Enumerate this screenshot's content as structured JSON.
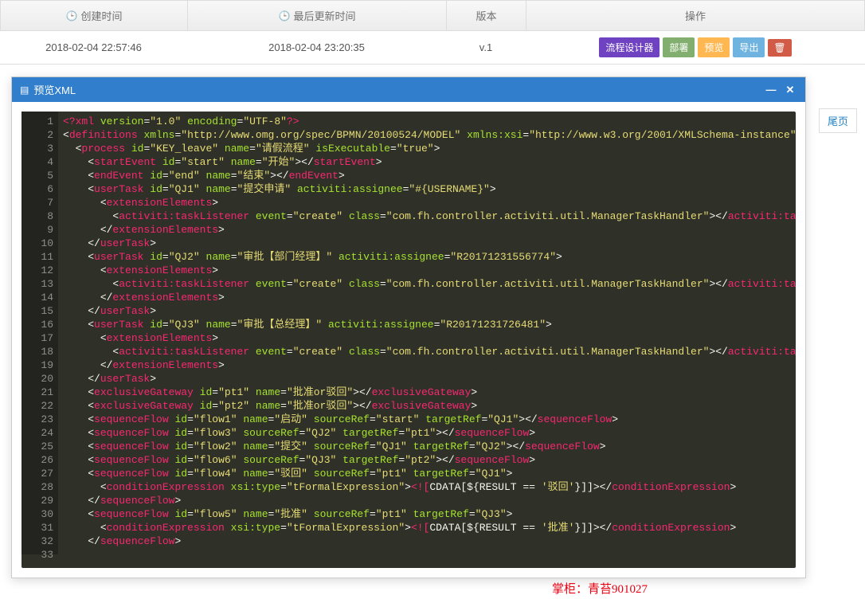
{
  "table": {
    "headers": {
      "created": "创建时间",
      "updated": "最后更新时间",
      "version": "版本",
      "actions": "操作"
    },
    "row": {
      "created": "2018-02-04 22:57:46",
      "updated": "2018-02-04 23:20:35",
      "version": "v.1"
    },
    "buttons": {
      "designer": "流程设计器",
      "deploy": "部署",
      "preview": "预览",
      "export": "导出"
    }
  },
  "pagination": {
    "last": "尾页"
  },
  "modal": {
    "title": "预览XML"
  },
  "watermark": "掌柜：青苔901027",
  "code": [
    [
      [
        "pi",
        "<?"
      ],
      [
        "tag",
        "xml"
      ],
      [
        "text",
        " "
      ],
      [
        "attr",
        "version"
      ],
      [
        "text",
        "="
      ],
      [
        "str",
        "\"1.0\""
      ],
      [
        "text",
        " "
      ],
      [
        "attr",
        "encoding"
      ],
      [
        "text",
        "="
      ],
      [
        "str",
        "\"UTF-8\""
      ],
      [
        "pi",
        "?>"
      ]
    ],
    [
      [
        "brkt",
        "<"
      ],
      [
        "tag",
        "definitions"
      ],
      [
        "text",
        " "
      ],
      [
        "attr",
        "xmlns"
      ],
      [
        "text",
        "="
      ],
      [
        "str",
        "\"http://www.omg.org/spec/BPMN/20100524/MODEL\""
      ],
      [
        "text",
        " "
      ],
      [
        "attr",
        "xmlns:xsi"
      ],
      [
        "text",
        "="
      ],
      [
        "str",
        "\"http://www.w3.org/2001/XMLSchema-instance\""
      ]
    ],
    [
      [
        "text",
        "  "
      ],
      [
        "brkt",
        "<"
      ],
      [
        "tag",
        "process"
      ],
      [
        "text",
        " "
      ],
      [
        "attr",
        "id"
      ],
      [
        "text",
        "="
      ],
      [
        "str",
        "\"KEY_leave\""
      ],
      [
        "text",
        " "
      ],
      [
        "attr",
        "name"
      ],
      [
        "text",
        "="
      ],
      [
        "str",
        "\"请假流程\""
      ],
      [
        "text",
        " "
      ],
      [
        "attr",
        "isExecutable"
      ],
      [
        "text",
        "="
      ],
      [
        "str",
        "\"true\""
      ],
      [
        "brkt",
        ">"
      ]
    ],
    [
      [
        "text",
        "    "
      ],
      [
        "brkt",
        "<"
      ],
      [
        "tag",
        "startEvent"
      ],
      [
        "text",
        " "
      ],
      [
        "attr",
        "id"
      ],
      [
        "text",
        "="
      ],
      [
        "str",
        "\"start\""
      ],
      [
        "text",
        " "
      ],
      [
        "attr",
        "name"
      ],
      [
        "text",
        "="
      ],
      [
        "str",
        "\"开始\""
      ],
      [
        "brkt",
        "></"
      ],
      [
        "tag",
        "startEvent"
      ],
      [
        "brkt",
        ">"
      ]
    ],
    [
      [
        "text",
        "    "
      ],
      [
        "brkt",
        "<"
      ],
      [
        "tag",
        "endEvent"
      ],
      [
        "text",
        " "
      ],
      [
        "attr",
        "id"
      ],
      [
        "text",
        "="
      ],
      [
        "str",
        "\"end\""
      ],
      [
        "text",
        " "
      ],
      [
        "attr",
        "name"
      ],
      [
        "text",
        "="
      ],
      [
        "str",
        "\"结束\""
      ],
      [
        "brkt",
        "></"
      ],
      [
        "tag",
        "endEvent"
      ],
      [
        "brkt",
        ">"
      ]
    ],
    [
      [
        "text",
        "    "
      ],
      [
        "brkt",
        "<"
      ],
      [
        "tag",
        "userTask"
      ],
      [
        "text",
        " "
      ],
      [
        "attr",
        "id"
      ],
      [
        "text",
        "="
      ],
      [
        "str",
        "\"QJ1\""
      ],
      [
        "text",
        " "
      ],
      [
        "attr",
        "name"
      ],
      [
        "text",
        "="
      ],
      [
        "str",
        "\"提交申请\""
      ],
      [
        "text",
        " "
      ],
      [
        "attr",
        "activiti:assignee"
      ],
      [
        "text",
        "="
      ],
      [
        "str",
        "\"#{USERNAME}\""
      ],
      [
        "brkt",
        ">"
      ]
    ],
    [
      [
        "text",
        "      "
      ],
      [
        "brkt",
        "<"
      ],
      [
        "tag",
        "extensionElements"
      ],
      [
        "brkt",
        ">"
      ]
    ],
    [
      [
        "text",
        "        "
      ],
      [
        "brkt",
        "<"
      ],
      [
        "tag",
        "activiti:taskListener"
      ],
      [
        "text",
        " "
      ],
      [
        "attr",
        "event"
      ],
      [
        "text",
        "="
      ],
      [
        "str",
        "\"create\""
      ],
      [
        "text",
        " "
      ],
      [
        "attr",
        "class"
      ],
      [
        "text",
        "="
      ],
      [
        "str",
        "\"com.fh.controller.activiti.util.ManagerTaskHandler\""
      ],
      [
        "brkt",
        "></"
      ],
      [
        "tag",
        "activiti:taskListener"
      ],
      [
        "brkt",
        ">"
      ]
    ],
    [
      [
        "text",
        "      "
      ],
      [
        "brkt",
        "</"
      ],
      [
        "tag",
        "extensionElements"
      ],
      [
        "brkt",
        ">"
      ]
    ],
    [
      [
        "text",
        "    "
      ],
      [
        "brkt",
        "</"
      ],
      [
        "tag",
        "userTask"
      ],
      [
        "brkt",
        ">"
      ]
    ],
    [
      [
        "text",
        "    "
      ],
      [
        "brkt",
        "<"
      ],
      [
        "tag",
        "userTask"
      ],
      [
        "text",
        " "
      ],
      [
        "attr",
        "id"
      ],
      [
        "text",
        "="
      ],
      [
        "str",
        "\"QJ2\""
      ],
      [
        "text",
        " "
      ],
      [
        "attr",
        "name"
      ],
      [
        "text",
        "="
      ],
      [
        "str",
        "\"审批【部门经理】\""
      ],
      [
        "text",
        " "
      ],
      [
        "attr",
        "activiti:assignee"
      ],
      [
        "text",
        "="
      ],
      [
        "str",
        "\"R20171231556774\""
      ],
      [
        "brkt",
        ">"
      ]
    ],
    [
      [
        "text",
        "      "
      ],
      [
        "brkt",
        "<"
      ],
      [
        "tag",
        "extensionElements"
      ],
      [
        "brkt",
        ">"
      ]
    ],
    [
      [
        "text",
        "        "
      ],
      [
        "brkt",
        "<"
      ],
      [
        "tag",
        "activiti:taskListener"
      ],
      [
        "text",
        " "
      ],
      [
        "attr",
        "event"
      ],
      [
        "text",
        "="
      ],
      [
        "str",
        "\"create\""
      ],
      [
        "text",
        " "
      ],
      [
        "attr",
        "class"
      ],
      [
        "text",
        "="
      ],
      [
        "str",
        "\"com.fh.controller.activiti.util.ManagerTaskHandler\""
      ],
      [
        "brkt",
        "></"
      ],
      [
        "tag",
        "activiti:taskListener"
      ],
      [
        "brkt",
        ">"
      ]
    ],
    [
      [
        "text",
        "      "
      ],
      [
        "brkt",
        "</"
      ],
      [
        "tag",
        "extensionElements"
      ],
      [
        "brkt",
        ">"
      ]
    ],
    [
      [
        "text",
        "    "
      ],
      [
        "brkt",
        "</"
      ],
      [
        "tag",
        "userTask"
      ],
      [
        "brkt",
        ">"
      ]
    ],
    [
      [
        "text",
        "    "
      ],
      [
        "brkt",
        "<"
      ],
      [
        "tag",
        "userTask"
      ],
      [
        "text",
        " "
      ],
      [
        "attr",
        "id"
      ],
      [
        "text",
        "="
      ],
      [
        "str",
        "\"QJ3\""
      ],
      [
        "text",
        " "
      ],
      [
        "attr",
        "name"
      ],
      [
        "text",
        "="
      ],
      [
        "str",
        "\"审批【总经理】\""
      ],
      [
        "text",
        " "
      ],
      [
        "attr",
        "activiti:assignee"
      ],
      [
        "text",
        "="
      ],
      [
        "str",
        "\"R20171231726481\""
      ],
      [
        "brkt",
        ">"
      ]
    ],
    [
      [
        "text",
        "      "
      ],
      [
        "brkt",
        "<"
      ],
      [
        "tag",
        "extensionElements"
      ],
      [
        "brkt",
        ">"
      ]
    ],
    [
      [
        "text",
        "        "
      ],
      [
        "brkt",
        "<"
      ],
      [
        "tag",
        "activiti:taskListener"
      ],
      [
        "text",
        " "
      ],
      [
        "attr",
        "event"
      ],
      [
        "text",
        "="
      ],
      [
        "str",
        "\"create\""
      ],
      [
        "text",
        " "
      ],
      [
        "attr",
        "class"
      ],
      [
        "text",
        "="
      ],
      [
        "str",
        "\"com.fh.controller.activiti.util.ManagerTaskHandler\""
      ],
      [
        "brkt",
        "></"
      ],
      [
        "tag",
        "activiti:taskListener"
      ],
      [
        "brkt",
        ">"
      ]
    ],
    [
      [
        "text",
        "      "
      ],
      [
        "brkt",
        "</"
      ],
      [
        "tag",
        "extensionElements"
      ],
      [
        "brkt",
        ">"
      ]
    ],
    [
      [
        "text",
        "    "
      ],
      [
        "brkt",
        "</"
      ],
      [
        "tag",
        "userTask"
      ],
      [
        "brkt",
        ">"
      ]
    ],
    [
      [
        "text",
        "    "
      ],
      [
        "brkt",
        "<"
      ],
      [
        "tag",
        "exclusiveGateway"
      ],
      [
        "text",
        " "
      ],
      [
        "attr",
        "id"
      ],
      [
        "text",
        "="
      ],
      [
        "str",
        "\"pt1\""
      ],
      [
        "text",
        " "
      ],
      [
        "attr",
        "name"
      ],
      [
        "text",
        "="
      ],
      [
        "str",
        "\"批准or驳回\""
      ],
      [
        "brkt",
        "></"
      ],
      [
        "tag",
        "exclusiveGateway"
      ],
      [
        "brkt",
        ">"
      ]
    ],
    [
      [
        "text",
        "    "
      ],
      [
        "brkt",
        "<"
      ],
      [
        "tag",
        "exclusiveGateway"
      ],
      [
        "text",
        " "
      ],
      [
        "attr",
        "id"
      ],
      [
        "text",
        "="
      ],
      [
        "str",
        "\"pt2\""
      ],
      [
        "text",
        " "
      ],
      [
        "attr",
        "name"
      ],
      [
        "text",
        "="
      ],
      [
        "str",
        "\"批准or驳回\""
      ],
      [
        "brkt",
        "></"
      ],
      [
        "tag",
        "exclusiveGateway"
      ],
      [
        "brkt",
        ">"
      ]
    ],
    [
      [
        "text",
        "    "
      ],
      [
        "brkt",
        "<"
      ],
      [
        "tag",
        "sequenceFlow"
      ],
      [
        "text",
        " "
      ],
      [
        "attr",
        "id"
      ],
      [
        "text",
        "="
      ],
      [
        "str",
        "\"flow1\""
      ],
      [
        "text",
        " "
      ],
      [
        "attr",
        "name"
      ],
      [
        "text",
        "="
      ],
      [
        "str",
        "\"启动\""
      ],
      [
        "text",
        " "
      ],
      [
        "attr",
        "sourceRef"
      ],
      [
        "text",
        "="
      ],
      [
        "str",
        "\"start\""
      ],
      [
        "text",
        " "
      ],
      [
        "attr",
        "targetRef"
      ],
      [
        "text",
        "="
      ],
      [
        "str",
        "\"QJ1\""
      ],
      [
        "brkt",
        "></"
      ],
      [
        "tag",
        "sequenceFlow"
      ],
      [
        "brkt",
        ">"
      ]
    ],
    [
      [
        "text",
        "    "
      ],
      [
        "brkt",
        "<"
      ],
      [
        "tag",
        "sequenceFlow"
      ],
      [
        "text",
        " "
      ],
      [
        "attr",
        "id"
      ],
      [
        "text",
        "="
      ],
      [
        "str",
        "\"flow3\""
      ],
      [
        "text",
        " "
      ],
      [
        "attr",
        "sourceRef"
      ],
      [
        "text",
        "="
      ],
      [
        "str",
        "\"QJ2\""
      ],
      [
        "text",
        " "
      ],
      [
        "attr",
        "targetRef"
      ],
      [
        "text",
        "="
      ],
      [
        "str",
        "\"pt1\""
      ],
      [
        "brkt",
        "></"
      ],
      [
        "tag",
        "sequenceFlow"
      ],
      [
        "brkt",
        ">"
      ]
    ],
    [
      [
        "text",
        "    "
      ],
      [
        "brkt",
        "<"
      ],
      [
        "tag",
        "sequenceFlow"
      ],
      [
        "text",
        " "
      ],
      [
        "attr",
        "id"
      ],
      [
        "text",
        "="
      ],
      [
        "str",
        "\"flow2\""
      ],
      [
        "text",
        " "
      ],
      [
        "attr",
        "name"
      ],
      [
        "text",
        "="
      ],
      [
        "str",
        "\"提交\""
      ],
      [
        "text",
        " "
      ],
      [
        "attr",
        "sourceRef"
      ],
      [
        "text",
        "="
      ],
      [
        "str",
        "\"QJ1\""
      ],
      [
        "text",
        " "
      ],
      [
        "attr",
        "targetRef"
      ],
      [
        "text",
        "="
      ],
      [
        "str",
        "\"QJ2\""
      ],
      [
        "brkt",
        "></"
      ],
      [
        "tag",
        "sequenceFlow"
      ],
      [
        "brkt",
        ">"
      ]
    ],
    [
      [
        "text",
        "    "
      ],
      [
        "brkt",
        "<"
      ],
      [
        "tag",
        "sequenceFlow"
      ],
      [
        "text",
        " "
      ],
      [
        "attr",
        "id"
      ],
      [
        "text",
        "="
      ],
      [
        "str",
        "\"flow6\""
      ],
      [
        "text",
        " "
      ],
      [
        "attr",
        "sourceRef"
      ],
      [
        "text",
        "="
      ],
      [
        "str",
        "\"QJ3\""
      ],
      [
        "text",
        " "
      ],
      [
        "attr",
        "targetRef"
      ],
      [
        "text",
        "="
      ],
      [
        "str",
        "\"pt2\""
      ],
      [
        "brkt",
        "></"
      ],
      [
        "tag",
        "sequenceFlow"
      ],
      [
        "brkt",
        ">"
      ]
    ],
    [
      [
        "text",
        "    "
      ],
      [
        "brkt",
        "<"
      ],
      [
        "tag",
        "sequenceFlow"
      ],
      [
        "text",
        " "
      ],
      [
        "attr",
        "id"
      ],
      [
        "text",
        "="
      ],
      [
        "str",
        "\"flow4\""
      ],
      [
        "text",
        " "
      ],
      [
        "attr",
        "name"
      ],
      [
        "text",
        "="
      ],
      [
        "str",
        "\"驳回\""
      ],
      [
        "text",
        " "
      ],
      [
        "attr",
        "sourceRef"
      ],
      [
        "text",
        "="
      ],
      [
        "str",
        "\"pt1\""
      ],
      [
        "text",
        " "
      ],
      [
        "attr",
        "targetRef"
      ],
      [
        "text",
        "="
      ],
      [
        "str",
        "\"QJ1\""
      ],
      [
        "brkt",
        ">"
      ]
    ],
    [
      [
        "text",
        "      "
      ],
      [
        "brkt",
        "<"
      ],
      [
        "tag",
        "conditionExpression"
      ],
      [
        "text",
        " "
      ],
      [
        "attr",
        "xsi:type"
      ],
      [
        "text",
        "="
      ],
      [
        "str",
        "\"tFormalExpression\""
      ],
      [
        "brkt",
        ">"
      ],
      [
        "pi",
        "<!["
      ],
      [
        "text",
        "CDATA[${RESULT == "
      ],
      [
        "str",
        "'驳回'"
      ],
      [
        "text",
        "}]]"
      ],
      [
        "brkt",
        "></"
      ],
      [
        "tag",
        "conditionExpression"
      ],
      [
        "brkt",
        ">"
      ]
    ],
    [
      [
        "text",
        "    "
      ],
      [
        "brkt",
        "</"
      ],
      [
        "tag",
        "sequenceFlow"
      ],
      [
        "brkt",
        ">"
      ]
    ],
    [
      [
        "text",
        "    "
      ],
      [
        "brkt",
        "<"
      ],
      [
        "tag",
        "sequenceFlow"
      ],
      [
        "text",
        " "
      ],
      [
        "attr",
        "id"
      ],
      [
        "text",
        "="
      ],
      [
        "str",
        "\"flow5\""
      ],
      [
        "text",
        " "
      ],
      [
        "attr",
        "name"
      ],
      [
        "text",
        "="
      ],
      [
        "str",
        "\"批准\""
      ],
      [
        "text",
        " "
      ],
      [
        "attr",
        "sourceRef"
      ],
      [
        "text",
        "="
      ],
      [
        "str",
        "\"pt1\""
      ],
      [
        "text",
        " "
      ],
      [
        "attr",
        "targetRef"
      ],
      [
        "text",
        "="
      ],
      [
        "str",
        "\"QJ3\""
      ],
      [
        "brkt",
        ">"
      ]
    ],
    [
      [
        "text",
        "      "
      ],
      [
        "brkt",
        "<"
      ],
      [
        "tag",
        "conditionExpression"
      ],
      [
        "text",
        " "
      ],
      [
        "attr",
        "xsi:type"
      ],
      [
        "text",
        "="
      ],
      [
        "str",
        "\"tFormalExpression\""
      ],
      [
        "brkt",
        ">"
      ],
      [
        "pi",
        "<!["
      ],
      [
        "text",
        "CDATA[${RESULT == "
      ],
      [
        "str",
        "'批准'"
      ],
      [
        "text",
        "}]]"
      ],
      [
        "brkt",
        "></"
      ],
      [
        "tag",
        "conditionExpression"
      ],
      [
        "brkt",
        ">"
      ]
    ],
    [
      [
        "text",
        "    "
      ],
      [
        "brkt",
        "</"
      ],
      [
        "tag",
        "sequenceFlow"
      ],
      [
        "brkt",
        ">"
      ]
    ],
    [
      [
        "text",
        "    "
      ]
    ]
  ]
}
